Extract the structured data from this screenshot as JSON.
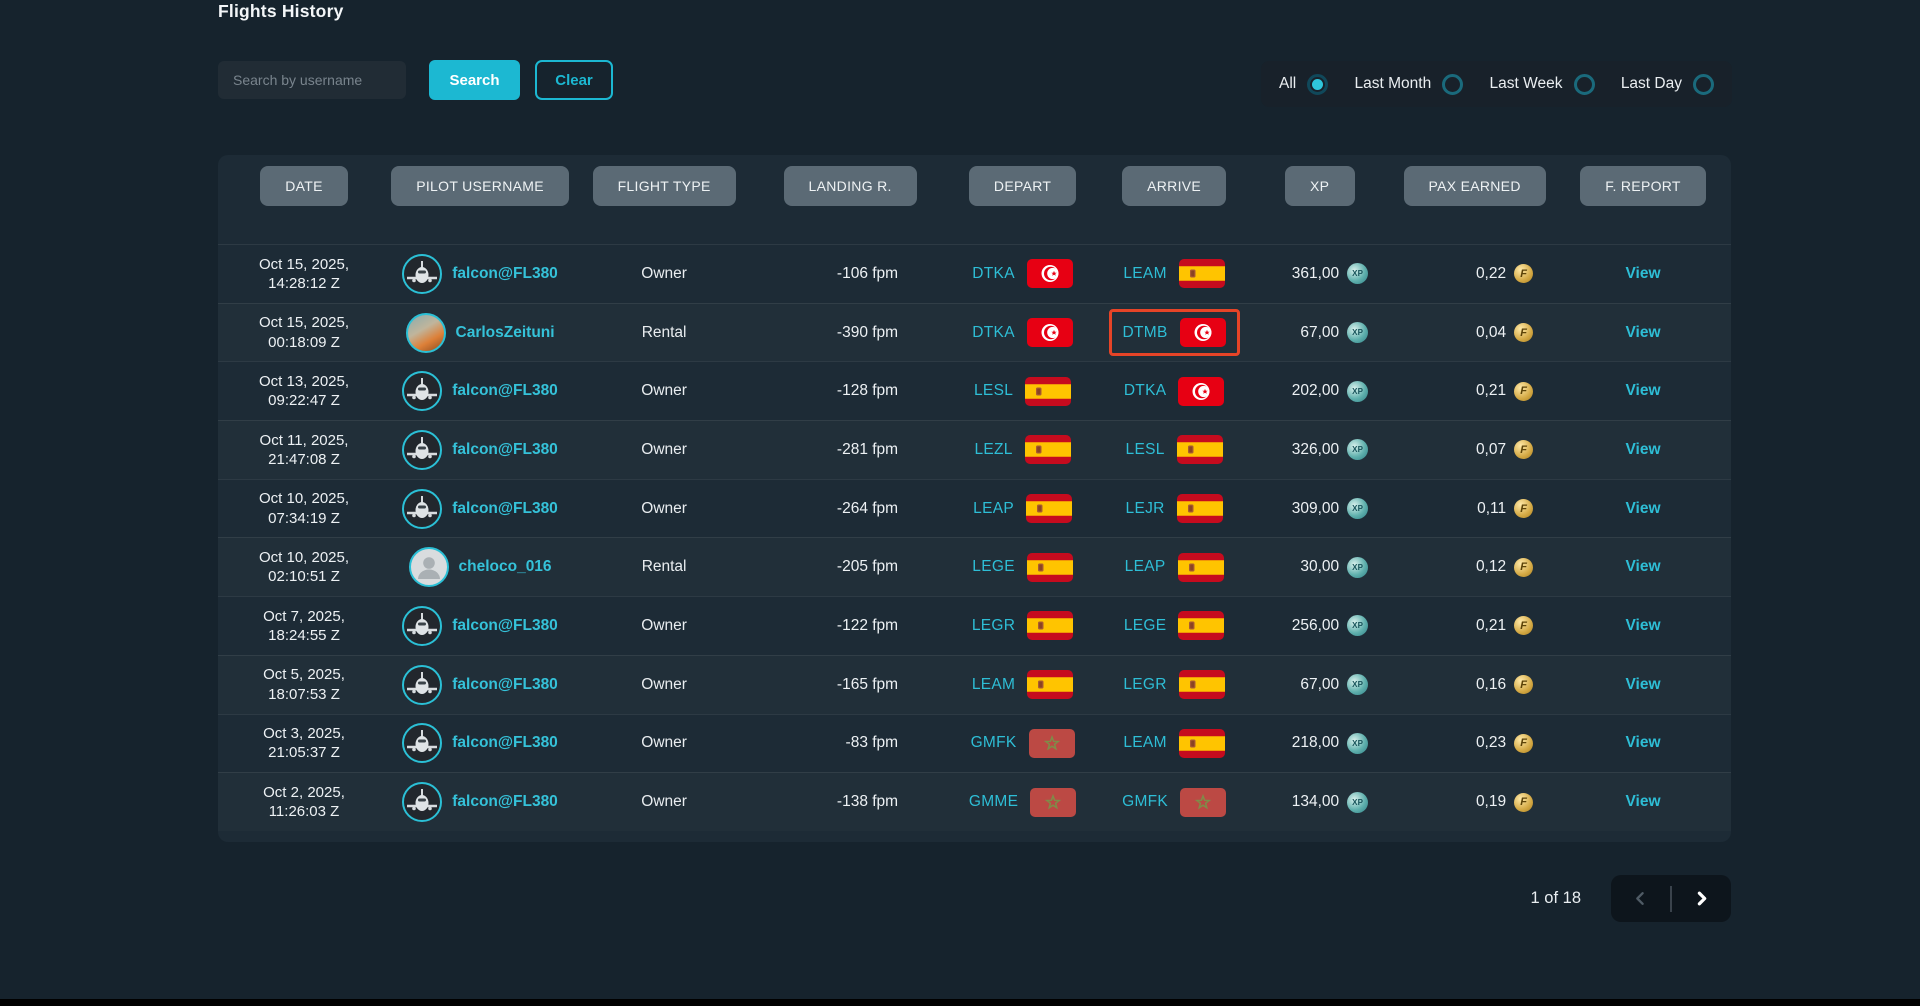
{
  "page": {
    "title": "Flights History"
  },
  "colors": {
    "accent": "#1cb8d2",
    "link_teal": "#2ebed6",
    "highlight_outline": "#e64427",
    "header_chip": "#5b6a75",
    "panel_bg": "#1d2b36",
    "page_bg": "#16232d"
  },
  "icons": {
    "xp": "xp-coin-icon",
    "pax": "franc-coin-icon",
    "prev": "chevron-left-icon",
    "next": "chevron-right-icon",
    "flag_es": "spain-flag-icon",
    "flag_tn": "tunisia-flag-icon",
    "flag_ma": "morocco-flag-icon"
  },
  "toolbar": {
    "search_placeholder": "Search by username",
    "search_value": "",
    "search_label": "Search",
    "clear_label": "Clear",
    "filters": [
      {
        "label": "All",
        "selected": true
      },
      {
        "label": "Last Month",
        "selected": false
      },
      {
        "label": "Last Week",
        "selected": false
      },
      {
        "label": "Last Day",
        "selected": false
      }
    ]
  },
  "table": {
    "headers": [
      "DATE",
      "PILOT USERNAME",
      "FLIGHT TYPE",
      "LANDING R.",
      "DEPART",
      "ARRIVE",
      "XP",
      "PAX EARNED",
      "F. REPORT"
    ],
    "rows": [
      {
        "date_line1": "Oct 15, 2025,",
        "date_line2": "14:28:12 Z",
        "pilot": "falcon@FL380",
        "avatar": "plane",
        "type": "Owner",
        "landing": "-106 fpm",
        "depart": {
          "code": "DTKA",
          "flag": "tn"
        },
        "arrive": {
          "code": "LEAM",
          "flag": "es",
          "highlight": false
        },
        "xp": "361,00",
        "pax": "0,22",
        "report": "View"
      },
      {
        "date_line1": "Oct 15, 2025,",
        "date_line2": "00:18:09 Z",
        "pilot": "CarlosZeituni",
        "avatar": "photo",
        "type": "Rental",
        "landing": "-390 fpm",
        "depart": {
          "code": "DTKA",
          "flag": "tn"
        },
        "arrive": {
          "code": "DTMB",
          "flag": "tn",
          "highlight": true
        },
        "xp": "67,00",
        "pax": "0,04",
        "report": "View"
      },
      {
        "date_line1": "Oct 13, 2025,",
        "date_line2": "09:22:47 Z",
        "pilot": "falcon@FL380",
        "avatar": "plane",
        "type": "Owner",
        "landing": "-128 fpm",
        "depart": {
          "code": "LESL",
          "flag": "es"
        },
        "arrive": {
          "code": "DTKA",
          "flag": "tn",
          "highlight": false
        },
        "xp": "202,00",
        "pax": "0,21",
        "report": "View"
      },
      {
        "date_line1": "Oct 11, 2025,",
        "date_line2": "21:47:08 Z",
        "pilot": "falcon@FL380",
        "avatar": "plane",
        "type": "Owner",
        "landing": "-281 fpm",
        "depart": {
          "code": "LEZL",
          "flag": "es"
        },
        "arrive": {
          "code": "LESL",
          "flag": "es",
          "highlight": false
        },
        "xp": "326,00",
        "pax": "0,07",
        "report": "View"
      },
      {
        "date_line1": "Oct 10, 2025,",
        "date_line2": "07:34:19 Z",
        "pilot": "falcon@FL380",
        "avatar": "plane",
        "type": "Owner",
        "landing": "-264 fpm",
        "depart": {
          "code": "LEAP",
          "flag": "es"
        },
        "arrive": {
          "code": "LEJR",
          "flag": "es",
          "highlight": false
        },
        "xp": "309,00",
        "pax": "0,11",
        "report": "View"
      },
      {
        "date_line1": "Oct 10, 2025,",
        "date_line2": "02:10:51 Z",
        "pilot": "cheloco_016",
        "avatar": "person",
        "type": "Rental",
        "landing": "-205 fpm",
        "depart": {
          "code": "LEGE",
          "flag": "es"
        },
        "arrive": {
          "code": "LEAP",
          "flag": "es",
          "highlight": false
        },
        "xp": "30,00",
        "pax": "0,12",
        "report": "View"
      },
      {
        "date_line1": "Oct 7, 2025,",
        "date_line2": "18:24:55 Z",
        "pilot": "falcon@FL380",
        "avatar": "plane",
        "type": "Owner",
        "landing": "-122 fpm",
        "depart": {
          "code": "LEGR",
          "flag": "es"
        },
        "arrive": {
          "code": "LEGE",
          "flag": "es",
          "highlight": false
        },
        "xp": "256,00",
        "pax": "0,21",
        "report": "View"
      },
      {
        "date_line1": "Oct 5, 2025,",
        "date_line2": "18:07:53 Z",
        "pilot": "falcon@FL380",
        "avatar": "plane",
        "type": "Owner",
        "landing": "-165 fpm",
        "depart": {
          "code": "LEAM",
          "flag": "es"
        },
        "arrive": {
          "code": "LEGR",
          "flag": "es",
          "highlight": false
        },
        "xp": "67,00",
        "pax": "0,16",
        "report": "View"
      },
      {
        "date_line1": "Oct 3, 2025,",
        "date_line2": "21:05:37 Z",
        "pilot": "falcon@FL380",
        "avatar": "plane",
        "type": "Owner",
        "landing": "-83 fpm",
        "depart": {
          "code": "GMFK",
          "flag": "ma"
        },
        "arrive": {
          "code": "LEAM",
          "flag": "es",
          "highlight": false
        },
        "xp": "218,00",
        "pax": "0,23",
        "report": "View"
      },
      {
        "date_line1": "Oct 2, 2025,",
        "date_line2": "11:26:03 Z",
        "pilot": "falcon@FL380",
        "avatar": "plane",
        "type": "Owner",
        "landing": "-138 fpm",
        "depart": {
          "code": "GMME",
          "flag": "ma"
        },
        "arrive": {
          "code": "GMFK",
          "flag": "ma",
          "highlight": false
        },
        "xp": "134,00",
        "pax": "0,19",
        "report": "View"
      }
    ]
  },
  "pagination": {
    "label": "1 of 18",
    "prev_enabled": false,
    "next_enabled": true
  }
}
